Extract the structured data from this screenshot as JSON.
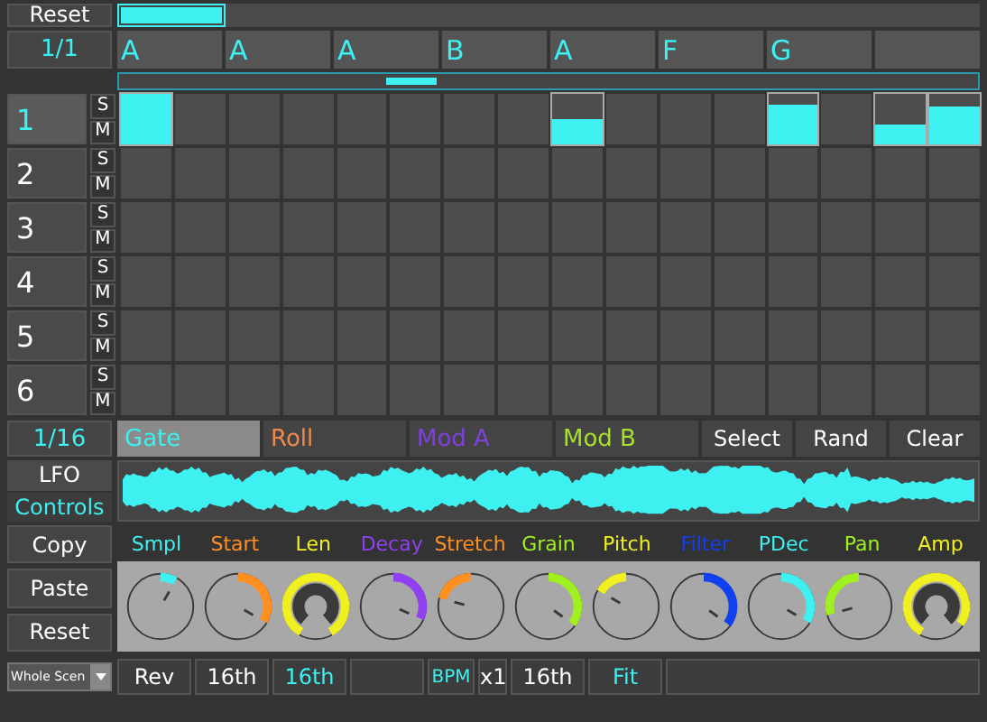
{
  "header": {
    "reset_button": "Reset",
    "position": {
      "level": 0.125
    }
  },
  "pattern_row": {
    "division": "1/1",
    "slots": [
      {
        "label": "A"
      },
      {
        "label": "A"
      },
      {
        "label": "A"
      },
      {
        "label": "B"
      },
      {
        "label": "A"
      },
      {
        "label": "F"
      },
      {
        "label": "G"
      }
    ]
  },
  "tracks": [
    {
      "number": "1",
      "selected": true,
      "solo": "S",
      "mute": "M",
      "steps": [
        {
          "active": true,
          "level": 1
        },
        {
          "active": false
        },
        {
          "active": false
        },
        {
          "active": false
        },
        {
          "active": false
        },
        {
          "active": false
        },
        {
          "active": false
        },
        {
          "active": false
        },
        {
          "active": true,
          "level": 0.5
        },
        {
          "active": false
        },
        {
          "active": false
        },
        {
          "active": false
        },
        {
          "active": true,
          "level": 0.8
        },
        {
          "active": false
        },
        {
          "active": true,
          "level": 0.4
        },
        {
          "active": true,
          "level": 0.75
        }
      ]
    },
    {
      "number": "2",
      "selected": false,
      "solo": "S",
      "mute": "M",
      "steps": [
        {
          "active": false
        },
        {
          "active": false
        },
        {
          "active": false
        },
        {
          "active": false
        },
        {
          "active": false
        },
        {
          "active": false
        },
        {
          "active": false
        },
        {
          "active": false
        },
        {
          "active": false
        },
        {
          "active": false
        },
        {
          "active": false
        },
        {
          "active": false
        },
        {
          "active": false
        },
        {
          "active": false
        },
        {
          "active": false
        },
        {
          "active": false
        }
      ]
    },
    {
      "number": "3",
      "selected": false,
      "solo": "S",
      "mute": "M",
      "steps": [
        {
          "active": false
        },
        {
          "active": false
        },
        {
          "active": false
        },
        {
          "active": false
        },
        {
          "active": false
        },
        {
          "active": false
        },
        {
          "active": false
        },
        {
          "active": false
        },
        {
          "active": false
        },
        {
          "active": false
        },
        {
          "active": false
        },
        {
          "active": false
        },
        {
          "active": false
        },
        {
          "active": false
        },
        {
          "active": false
        },
        {
          "active": false
        }
      ]
    },
    {
      "number": "4",
      "selected": false,
      "solo": "S",
      "mute": "M",
      "steps": [
        {
          "active": false
        },
        {
          "active": false
        },
        {
          "active": false
        },
        {
          "active": false
        },
        {
          "active": false
        },
        {
          "active": false
        },
        {
          "active": false
        },
        {
          "active": false
        },
        {
          "active": false
        },
        {
          "active": false
        },
        {
          "active": false
        },
        {
          "active": false
        },
        {
          "active": false
        },
        {
          "active": false
        },
        {
          "active": false
        },
        {
          "active": false
        }
      ]
    },
    {
      "number": "5",
      "selected": false,
      "solo": "S",
      "mute": "M",
      "steps": [
        {
          "active": false
        },
        {
          "active": false
        },
        {
          "active": false
        },
        {
          "active": false
        },
        {
          "active": false
        },
        {
          "active": false
        },
        {
          "active": false
        },
        {
          "active": false
        },
        {
          "active": false
        },
        {
          "active": false
        },
        {
          "active": false
        },
        {
          "active": false
        },
        {
          "active": false
        },
        {
          "active": false
        },
        {
          "active": false
        },
        {
          "active": false
        }
      ]
    },
    {
      "number": "6",
      "selected": false,
      "solo": "S",
      "mute": "M",
      "steps": [
        {
          "active": false
        },
        {
          "active": false
        },
        {
          "active": false
        },
        {
          "active": false
        },
        {
          "active": false
        },
        {
          "active": false
        },
        {
          "active": false
        },
        {
          "active": false
        },
        {
          "active": false
        },
        {
          "active": false
        },
        {
          "active": false
        },
        {
          "active": false
        },
        {
          "active": false
        },
        {
          "active": false
        },
        {
          "active": false
        },
        {
          "active": false
        }
      ]
    }
  ],
  "step_division": "1/16",
  "mode_tabs": [
    {
      "label": "Gate",
      "selected": true,
      "color": "#3ef0f0"
    },
    {
      "label": "Roll",
      "selected": false,
      "color": "#f08a4a"
    },
    {
      "label": "Mod A",
      "selected": false,
      "color": "#8040e0"
    },
    {
      "label": "Mod B",
      "selected": false,
      "color": "#a8e030"
    }
  ],
  "actions": [
    "Select",
    "Rand",
    "Clear"
  ],
  "view_toggle": [
    {
      "label": "LFO",
      "selected": false
    },
    {
      "label": "Controls",
      "selected": true
    }
  ],
  "side_buttons": [
    "Copy",
    "Paste",
    "Reset"
  ],
  "scope_dropdown": {
    "value": "Whole Scen"
  },
  "knobs": [
    {
      "label": "Smpl",
      "color": "#3ef0f0",
      "kind": "center",
      "level": 0.6
    },
    {
      "label": "Start",
      "color": "#ff9020",
      "kind": "center",
      "level": 0.9
    },
    {
      "label": "Len",
      "color": "#f0f020",
      "kind": "full",
      "level": 1
    },
    {
      "label": "Decay",
      "color": "#9040f0",
      "kind": "center",
      "level": 0.88
    },
    {
      "label": "Stretch",
      "color": "#ff9020",
      "kind": "center",
      "level": 0.25
    },
    {
      "label": "Grain",
      "color": "#a0f020",
      "kind": "center",
      "level": 0.92
    },
    {
      "label": "Pitch",
      "color": "#f0f020",
      "kind": "center",
      "level": 0.3
    },
    {
      "label": "Filter",
      "color": "#1040f0",
      "kind": "center",
      "level": 0.92
    },
    {
      "label": "PDec",
      "color": "#3ef0f0",
      "kind": "center",
      "level": 0.9
    },
    {
      "label": "Pan",
      "color": "#a0f020",
      "kind": "center",
      "level": 0.15
    },
    {
      "label": "Amp",
      "color": "#f0f020",
      "kind": "full",
      "level": 0.92
    }
  ],
  "bottom_row": [
    {
      "label": "Rev",
      "kind": "cell",
      "active": false
    },
    {
      "label": "16th",
      "kind": "cell",
      "active": false
    },
    {
      "label": "16th",
      "kind": "cell",
      "active": true
    },
    {
      "kind": "cell"
    },
    {
      "label": "BPM",
      "kind": "small",
      "active": true
    },
    {
      "label": "x1",
      "kind": "tiny",
      "active": false
    },
    {
      "label": "16th",
      "kind": "cell",
      "active": false
    },
    {
      "label": "Fit",
      "kind": "cell",
      "active": true
    },
    {
      "kind": "rest"
    }
  ]
}
